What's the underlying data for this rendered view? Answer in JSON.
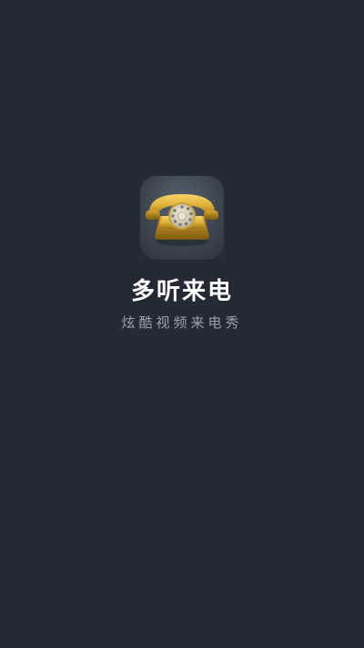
{
  "app": {
    "name": "多听来电",
    "tagline": "炫酷视频来电秀",
    "icon": "rotary-telephone-icon"
  },
  "colors": {
    "background": "#242a33",
    "title": "#ffffff",
    "tagline": "#9aa1a9",
    "icon_accent": "#e0b23a"
  }
}
